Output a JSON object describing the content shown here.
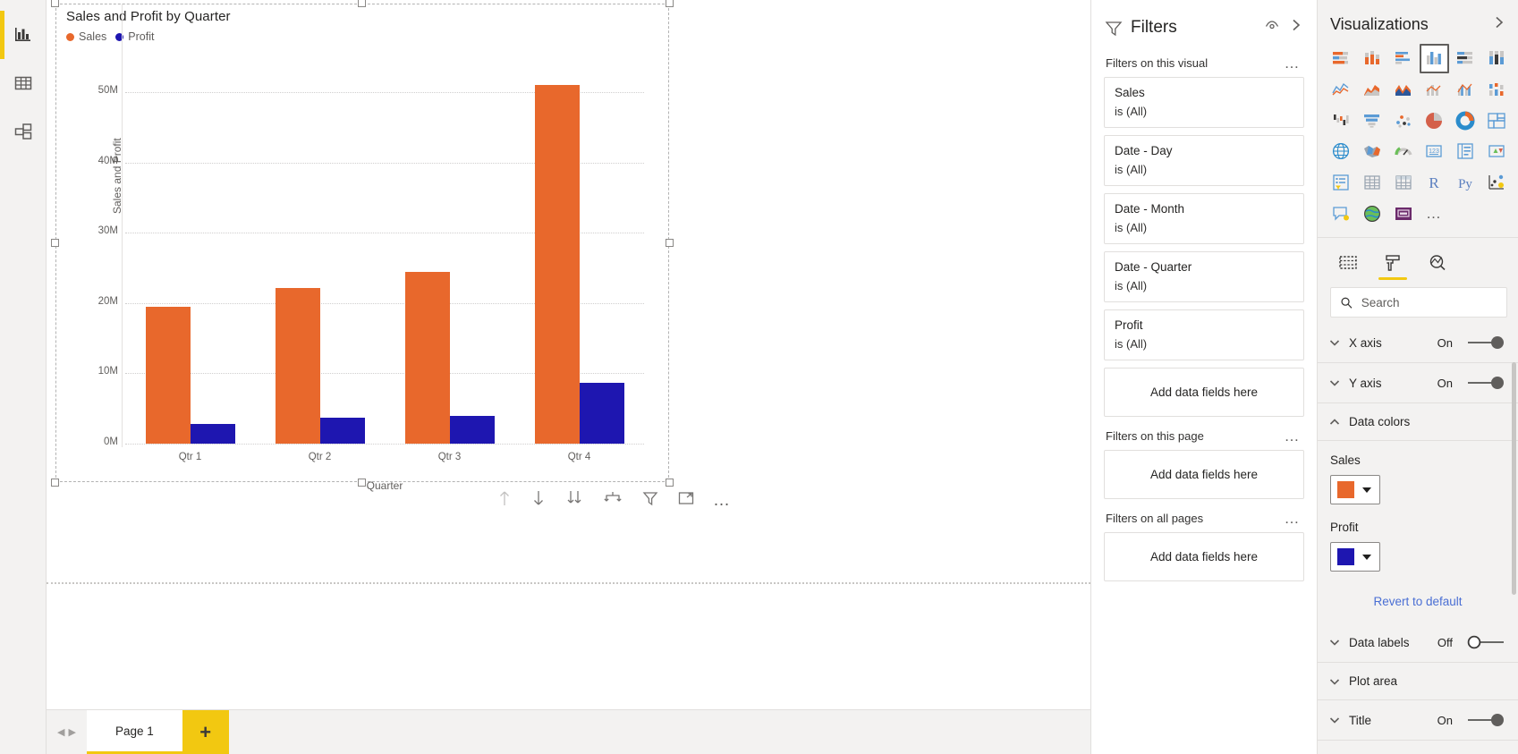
{
  "left_rail": {
    "items": [
      {
        "name": "report-view",
        "icon": "report-view-icon",
        "active": true
      },
      {
        "name": "data-view",
        "icon": "data-table-icon",
        "active": false
      },
      {
        "name": "model-view",
        "icon": "model-relationship-icon",
        "active": false
      }
    ]
  },
  "visual": {
    "title": "Sales and Profit by Quarter",
    "legend": [
      {
        "label": "Sales",
        "color": "#E8682C"
      },
      {
        "label": "Profit",
        "color": "#1E16B0"
      }
    ],
    "toolbar": [
      {
        "name": "drill-up-icon",
        "label": "Drill up",
        "disabled": true
      },
      {
        "name": "drill-down-icon",
        "label": "Drill down",
        "disabled": false
      },
      {
        "name": "expand-next-level-icon",
        "label": "Go to the next level in the hierarchy",
        "disabled": false
      },
      {
        "name": "expand-all-down-icon",
        "label": "Expand all down one level in the hierarchy",
        "disabled": false
      },
      {
        "name": "filter-icon",
        "label": "Filters",
        "disabled": false
      },
      {
        "name": "focus-mode-icon",
        "label": "Focus mode",
        "disabled": false
      },
      {
        "name": "more-options-icon",
        "label": "More options",
        "disabled": false
      }
    ],
    "more_options": "…"
  },
  "chart_data": {
    "type": "bar",
    "title": "Sales and Profit by Quarter",
    "xlabel": "Quarter",
    "ylabel": "Sales and Profit",
    "categories": [
      "Qtr 1",
      "Qtr 2",
      "Qtr 3",
      "Qtr 4"
    ],
    "series": [
      {
        "name": "Sales",
        "color": "#E8682C",
        "values": [
          19500000,
          22200000,
          24500000,
          51000000
        ]
      },
      {
        "name": "Profit",
        "color": "#1E16B0",
        "values": [
          2800000,
          3700000,
          4000000,
          8600000
        ]
      }
    ],
    "ylim": [
      0,
      55000000
    ],
    "yticks": [
      0,
      10000000,
      20000000,
      30000000,
      40000000,
      50000000
    ],
    "ytick_labels": [
      "0M",
      "10M",
      "20M",
      "30M",
      "40M",
      "50M"
    ],
    "grid": true,
    "legend_position": "top-left"
  },
  "pagebar": {
    "prev_arrow": "◀",
    "next_arrow": "▶",
    "tabs": [
      {
        "label": "Page 1",
        "active": true
      }
    ],
    "add_label": "+"
  },
  "filters": {
    "title": "Filters",
    "eye_icon": "hide-pane-eye-icon",
    "collapse_icon": "chevron-right-icon",
    "sections": [
      {
        "heading": "Filters on this visual",
        "ellipsis": "…",
        "cards": [
          {
            "field": "Sales",
            "state": "is (All)"
          },
          {
            "field": "Date - Day",
            "state": "is (All)"
          },
          {
            "field": "Date - Month",
            "state": "is (All)"
          },
          {
            "field": "Date - Quarter",
            "state": "is (All)"
          },
          {
            "field": "Profit",
            "state": "is (All)"
          }
        ],
        "dropzone": "Add data fields here"
      },
      {
        "heading": "Filters on this page",
        "ellipsis": "…",
        "cards": [],
        "dropzone": "Add data fields here"
      },
      {
        "heading": "Filters on all pages",
        "ellipsis": "…",
        "cards": [],
        "dropzone": "Add data fields here"
      }
    ]
  },
  "visualizations": {
    "title": "Visualizations",
    "expand_icon": "chevron-right-icon",
    "gallery": [
      {
        "name": "stacked-bar-chart-icon",
        "selected": false
      },
      {
        "name": "stacked-column-chart-icon",
        "selected": false
      },
      {
        "name": "clustered-bar-chart-icon",
        "selected": false
      },
      {
        "name": "clustered-column-chart-icon",
        "selected": true
      },
      {
        "name": "100-stacked-bar-chart-icon",
        "selected": false
      },
      {
        "name": "100-stacked-column-chart-icon",
        "selected": false
      },
      {
        "name": "line-chart-icon",
        "selected": false
      },
      {
        "name": "area-chart-icon",
        "selected": false
      },
      {
        "name": "stacked-area-chart-icon",
        "selected": false
      },
      {
        "name": "line-and-stacked-column-chart-icon",
        "selected": false
      },
      {
        "name": "line-and-clustered-column-chart-icon",
        "selected": false
      },
      {
        "name": "ribbon-chart-icon",
        "selected": false
      },
      {
        "name": "waterfall-chart-icon",
        "selected": false
      },
      {
        "name": "funnel-chart-icon",
        "selected": false
      },
      {
        "name": "scatter-chart-icon",
        "selected": false
      },
      {
        "name": "pie-chart-icon",
        "selected": false
      },
      {
        "name": "donut-chart-icon",
        "selected": false
      },
      {
        "name": "treemap-icon",
        "selected": false
      },
      {
        "name": "map-icon",
        "selected": false
      },
      {
        "name": "filled-map-icon",
        "selected": false
      },
      {
        "name": "gauge-icon",
        "selected": false
      },
      {
        "name": "card-icon",
        "selected": false
      },
      {
        "name": "multi-row-card-icon",
        "selected": false
      },
      {
        "name": "kpi-icon",
        "selected": false
      },
      {
        "name": "slicer-icon",
        "selected": false
      },
      {
        "name": "table-icon",
        "selected": false
      },
      {
        "name": "matrix-icon",
        "selected": false
      },
      {
        "name": "r-script-visual-icon",
        "selected": false
      },
      {
        "name": "python-visual-icon",
        "selected": false
      },
      {
        "name": "key-influencers-icon",
        "selected": false
      },
      {
        "name": "qna-visual-icon",
        "selected": false
      },
      {
        "name": "arcgis-map-icon",
        "selected": false
      },
      {
        "name": "paginated-report-icon",
        "selected": false
      }
    ],
    "gallery_more": "…",
    "pane_tabs": [
      {
        "name": "fields-tab",
        "icon": "fields-grid-icon",
        "active": false
      },
      {
        "name": "format-tab",
        "icon": "paint-roller-icon",
        "active": true
      },
      {
        "name": "analytics-tab",
        "icon": "analytics-magnifier-icon",
        "active": false
      }
    ],
    "search": {
      "placeholder": "Search",
      "value": ""
    },
    "format_rows": [
      {
        "label": "X axis",
        "state": "On",
        "toggle": true,
        "expanded": false
      },
      {
        "label": "Y axis",
        "state": "On",
        "toggle": true,
        "expanded": false
      },
      {
        "label": "Data colors",
        "state": "",
        "toggle": null,
        "expanded": true
      }
    ],
    "data_colors": {
      "items": [
        {
          "label": "Sales",
          "color": "#E8682C"
        },
        {
          "label": "Profit",
          "color": "#1E16B0"
        }
      ],
      "revert": "Revert to default"
    },
    "format_rows_bottom": [
      {
        "label": "Data labels",
        "state": "Off",
        "toggle": false,
        "expanded": false
      },
      {
        "label": "Plot area",
        "state": "",
        "toggle": null,
        "expanded": false
      },
      {
        "label": "Title",
        "state": "On",
        "toggle": true,
        "expanded": false
      }
    ]
  }
}
